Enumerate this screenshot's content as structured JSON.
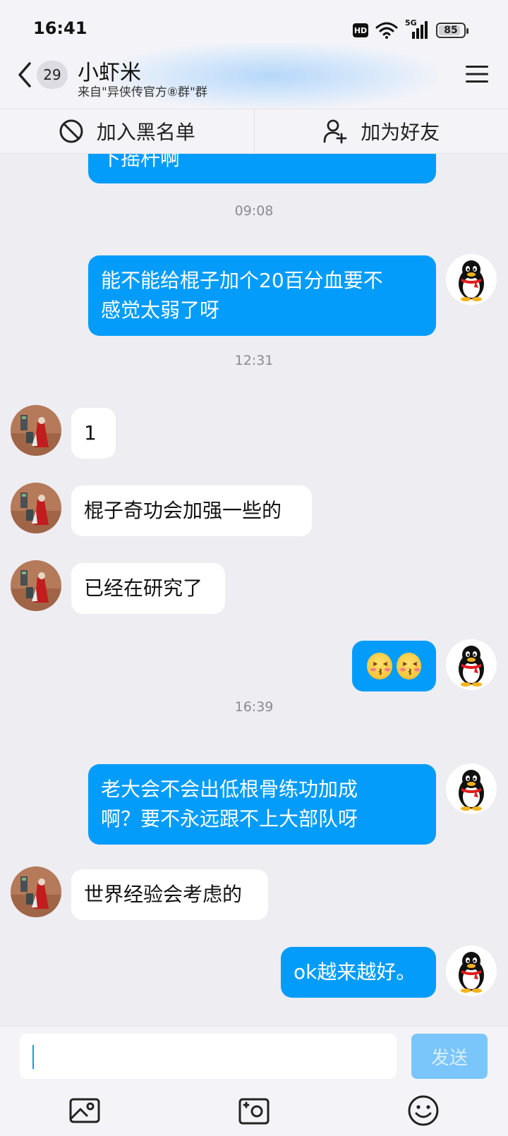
{
  "status_bar": {
    "time": "16:41",
    "hd": "HD",
    "network": "5G",
    "battery": "85"
  },
  "header": {
    "unread_count": "29",
    "title": "小虾米",
    "subtitle": "来自\"异侠传官方⑧群\"群"
  },
  "actions": {
    "block_label": "加入黑名单",
    "add_friend_label": "加为好友"
  },
  "messages": [
    {
      "type": "out",
      "text": "下摇杆啊"
    },
    {
      "type": "time",
      "text": "09:08"
    },
    {
      "type": "out",
      "line1": "能不能给棍子加个20百分血要不",
      "line2": "感觉太弱了呀"
    },
    {
      "type": "time",
      "text": "12:31"
    },
    {
      "type": "in",
      "text": "1"
    },
    {
      "type": "in",
      "text": "棍子奇功会加强一些的"
    },
    {
      "type": "in",
      "text": "已经在研究了"
    },
    {
      "type": "out",
      "emoji": "kiss-face-emoji x2"
    },
    {
      "type": "time",
      "text": "16:39"
    },
    {
      "type": "out",
      "line1": "老大会不会出低根骨练功加成",
      "line2": "啊？要不永远跟不上大部队呀"
    },
    {
      "type": "in",
      "text": "世界经验会考虑的"
    },
    {
      "type": "out",
      "text": "ok越来越好。"
    }
  ],
  "input": {
    "value": "",
    "send_label": "发送"
  },
  "colors": {
    "outgoing_bubble": "#049cfa",
    "incoming_bubble": "#ffffff",
    "background": "#ededf2",
    "send_button": "#7ac5f9"
  }
}
